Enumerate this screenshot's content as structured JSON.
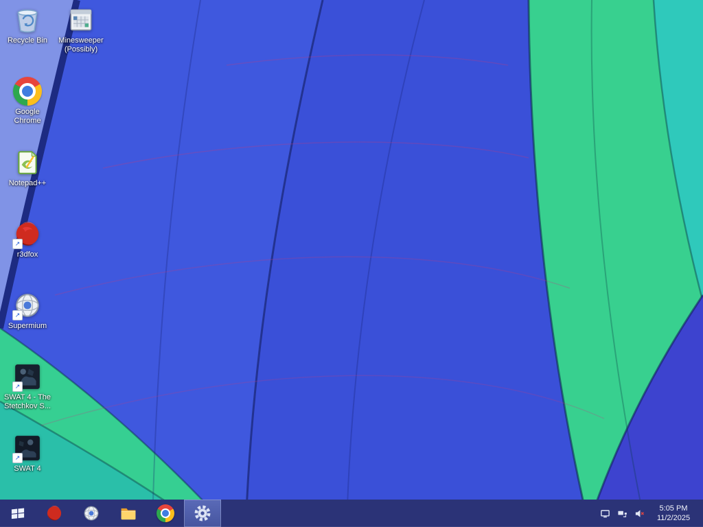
{
  "wallpaper": {
    "colors": {
      "periwinkle": "#8093e6",
      "royal_blue_left": "#3f58de",
      "royal_blue_center": "#3a50d8",
      "navy_stripe": "#1d2b82",
      "green_right": "#38d08f",
      "teal_corner": "#2fc9bb",
      "purple_blue_corner": "#3d43cf",
      "green_left": "#36cf92",
      "teal_left": "#2abfa9"
    }
  },
  "desktop": {
    "icons": [
      {
        "name": "recycle-bin",
        "label": "Recycle Bin"
      },
      {
        "name": "minesweeper",
        "label": "Minesweeper (Possibly)"
      },
      {
        "name": "google-chrome",
        "label": "Google Chrome"
      },
      {
        "name": "notepad-plus-plus",
        "label": "Notepad++"
      },
      {
        "name": "r3dfox",
        "label": "r3dfox"
      },
      {
        "name": "supermium",
        "label": "Supermium"
      },
      {
        "name": "swat4-stetchkov",
        "label": "SWAT 4 - The Stetchkov S..."
      },
      {
        "name": "swat4",
        "label": "SWAT 4"
      }
    ]
  },
  "taskbar": {
    "pinned_icons": [
      "start",
      "r3dfox",
      "supermium",
      "file-explorer",
      "google-chrome",
      "settings"
    ],
    "active_icon": "settings",
    "tray": {
      "icons": [
        "hardware-icon",
        "network-icon",
        "volume-muted-icon"
      ],
      "time": "5:05 PM",
      "date": "11/2/2025"
    }
  }
}
